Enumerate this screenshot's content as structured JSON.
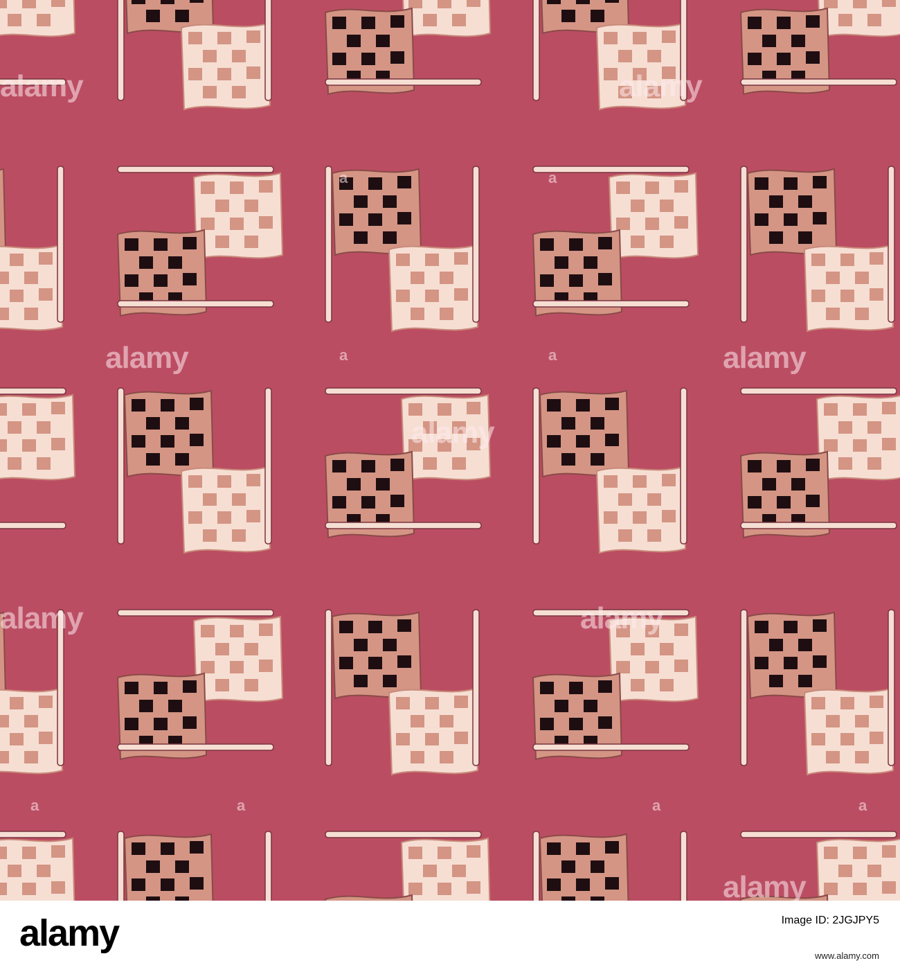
{
  "pattern": {
    "background": "#BB4D62",
    "colors": {
      "light_flag": "#F6DED3",
      "light_check": "#D49584",
      "dark_flag": "#D49584",
      "dark_check": "#1E0E12",
      "pole": "#F6DED3",
      "pole_outline": "#7A3440"
    },
    "motif": "checkered-flag-pair"
  },
  "watermark": {
    "word": "alamy",
    "letter": "a"
  },
  "footer": {
    "logo": "alamy",
    "image_id_label": "Image ID: 2JGJPY5",
    "image_id": "2JGJPY5",
    "url": "www.alamy.com"
  }
}
